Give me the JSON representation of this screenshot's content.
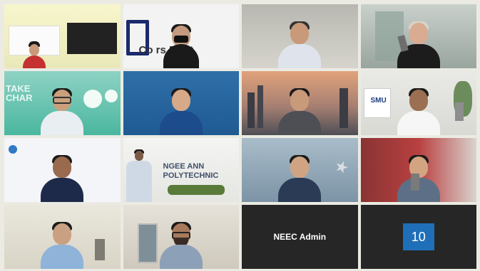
{
  "tiles": [
    {
      "label": "",
      "name": "tile-1"
    },
    {
      "label": "",
      "name": "tile-2",
      "sign": "Co  rs Print"
    },
    {
      "label": "",
      "name": "tile-3"
    },
    {
      "label": "",
      "name": "tile-4"
    },
    {
      "label": "",
      "name": "tile-5",
      "sign": "TAKE CHAR"
    },
    {
      "label": "",
      "name": "tile-6"
    },
    {
      "label": "",
      "name": "tile-7"
    },
    {
      "label": "",
      "name": "tile-8",
      "sign": "SMU"
    },
    {
      "label": "",
      "name": "tile-9"
    },
    {
      "label": "",
      "name": "tile-10",
      "sign": "NGEE ANN POLYTECHNIC"
    },
    {
      "label": "",
      "name": "tile-11"
    },
    {
      "label": "",
      "name": "tile-12"
    },
    {
      "label": "",
      "name": "tile-13"
    },
    {
      "label": "",
      "name": "tile-14"
    },
    {
      "label": "",
      "name": "tile-15",
      "center_name": "NEEC Admin"
    },
    {
      "label": "",
      "name": "tile-16",
      "number": "10"
    }
  ],
  "colors": {
    "page_background": "#ebebe3",
    "number_tile": "#1f6fb8"
  }
}
